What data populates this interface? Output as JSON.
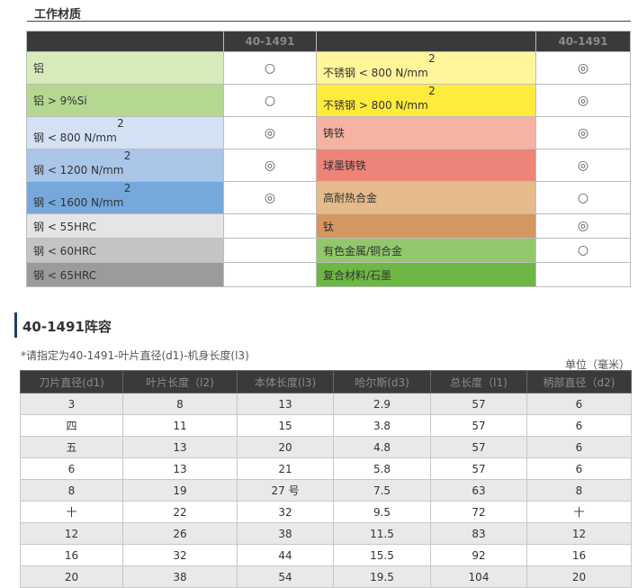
{
  "materials_section": {
    "title": "工作材质"
  },
  "materials": {
    "header": {
      "col1": "",
      "col2": "40-1491",
      "col3": "",
      "col4": "40-1491"
    },
    "rows": [
      {
        "left": "铝",
        "left_sup": "",
        "left_color": "#d8ebbb",
        "left_mark": "○",
        "right": "不锈钢 < 800 N/mm",
        "right_sup": "2",
        "right_color": "#fff59a",
        "right_mark": "◎"
      },
      {
        "left": "铝 > 9%Si",
        "left_sup": "",
        "left_color": "#b4d892",
        "left_mark": "○",
        "right": "不锈钢 > 800 N/mm",
        "right_sup": "2",
        "right_color": "#ffeb3c",
        "right_mark": "◎"
      },
      {
        "left": "钢 < 800 N/mm",
        "left_sup": "2",
        "left_color": "#d3e1f4",
        "left_mark": "◎",
        "right": "铸铁",
        "right_sup": "",
        "right_color": "#f6b3a4",
        "right_mark": "◎"
      },
      {
        "left": "钢 < 1200 N/mm",
        "left_sup": "2",
        "left_color": "#a9c5e8",
        "left_mark": "◎",
        "right": "球墨铸铁",
        "right_sup": "",
        "right_color": "#ee8478",
        "right_mark": "◎"
      },
      {
        "left": "钢 < 1600 N/mm",
        "left_sup": "2",
        "left_color": "#76a8db",
        "left_mark": "◎",
        "right": "高耐热合金",
        "right_sup": "",
        "right_color": "#e5bb8b",
        "right_mark": "○"
      },
      {
        "left": "钢 < 55HRC",
        "left_sup": "",
        "left_color": "#e5e5e5",
        "left_mark": "",
        "right": "钛",
        "right_sup": "",
        "right_color": "#d6965f",
        "right_mark": "◎"
      },
      {
        "left": "钢 < 60HRC",
        "left_sup": "",
        "left_color": "#c4c4c4",
        "left_mark": "",
        "right": "有色金属/铜合金",
        "right_sup": "",
        "right_color": "#92c86c",
        "right_mark": "○"
      },
      {
        "left": "钢 < 65HRC",
        "left_sup": "",
        "left_color": "#9b9b9b",
        "left_mark": "",
        "right": "复合材料/石墨",
        "right_sup": "",
        "right_color": "#6db744",
        "right_mark": ""
      }
    ]
  },
  "lineup": {
    "title": "40-1491阵容",
    "note": "*请指定为40-1491-叶片直径(d1)-机身长度(l3)",
    "unit": "单位（毫米）",
    "headers": [
      "刀片直径(d1)",
      "叶片长度（l2)",
      "本体长度(l3)",
      "哈尔斯(d3)",
      "总长度（l1)",
      "柄部直径（d2)"
    ],
    "rows": [
      [
        "3",
        "8",
        "13",
        "2.9",
        "57",
        "6"
      ],
      [
        "四",
        "11",
        "15",
        "3.8",
        "57",
        "6"
      ],
      [
        "五",
        "13",
        "20",
        "4.8",
        "57",
        "6"
      ],
      [
        "6",
        "13",
        "21",
        "5.8",
        "57",
        "6"
      ],
      [
        "8",
        "19",
        "27 号",
        "7.5",
        "63",
        "8"
      ],
      [
        "十",
        "22",
        "32",
        "9.5",
        "72",
        "十"
      ],
      [
        "12",
        "26",
        "38",
        "11.5",
        "83",
        "12"
      ],
      [
        "16",
        "32",
        "44",
        "15.5",
        "92",
        "16"
      ],
      [
        "20",
        "38",
        "54",
        "19.5",
        "104",
        "20"
      ]
    ]
  }
}
